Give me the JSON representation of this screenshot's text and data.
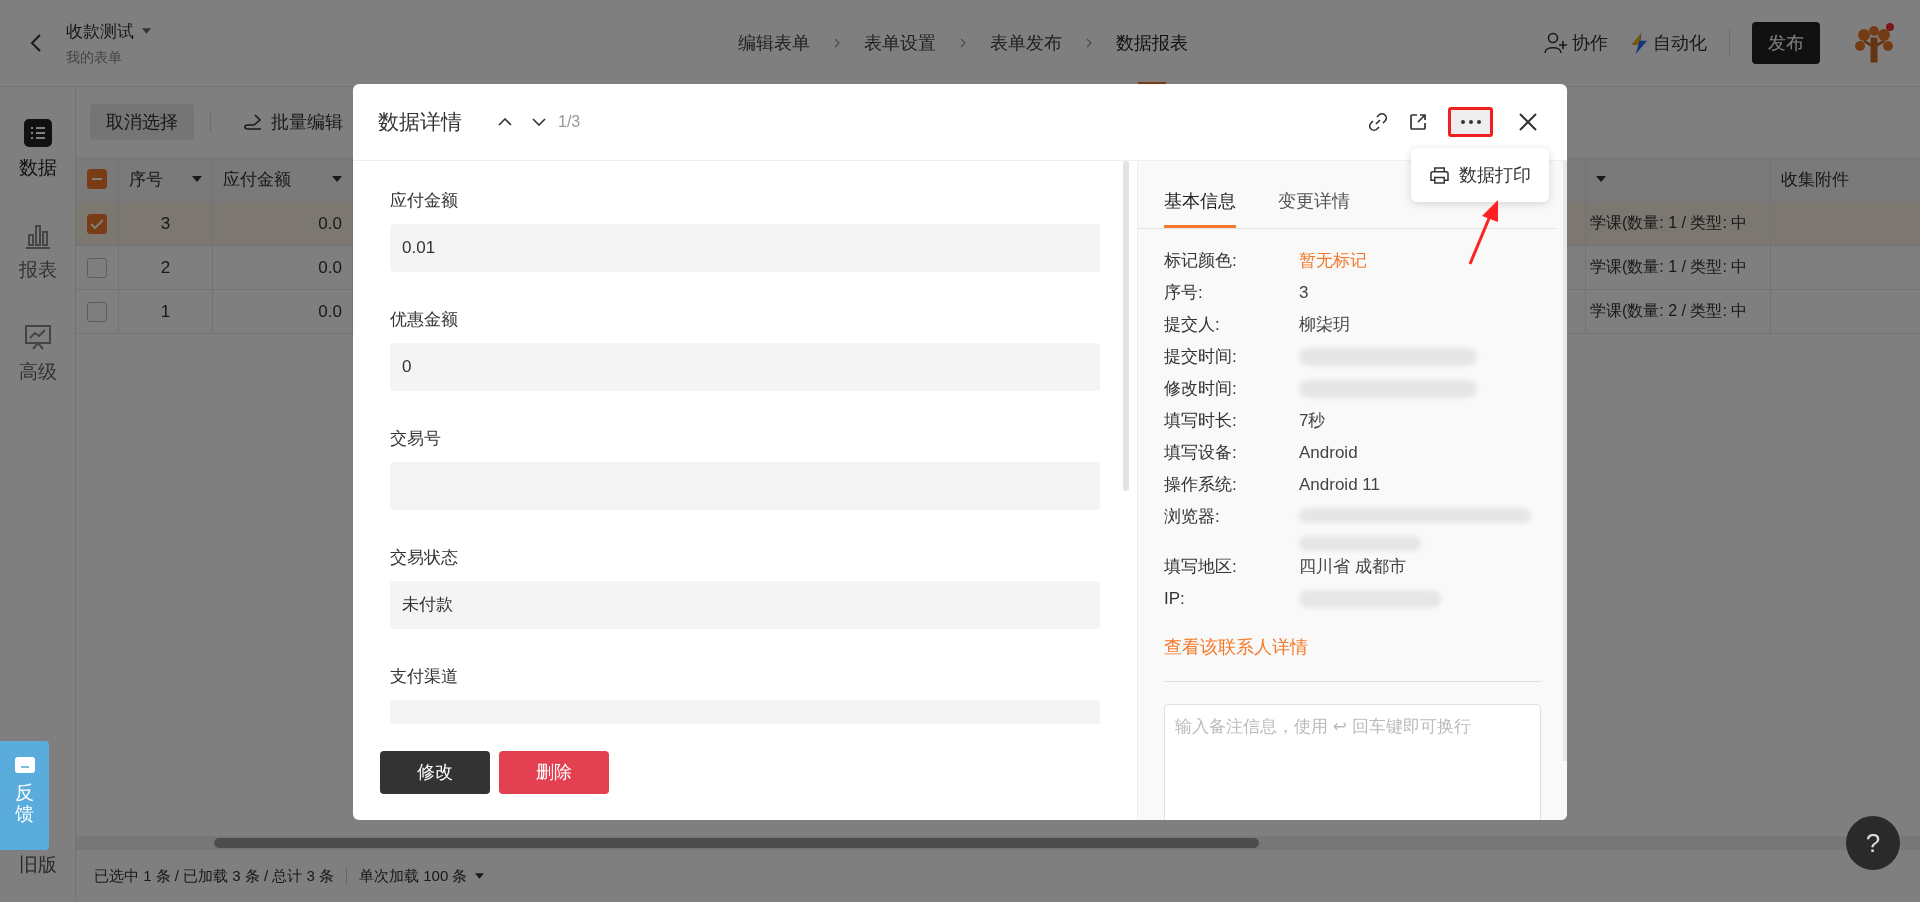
{
  "header": {
    "title": "收款测试",
    "subtitle": "我的表单",
    "steps": [
      {
        "label": "编辑表单",
        "selected": false
      },
      {
        "label": "表单设置",
        "selected": false
      },
      {
        "label": "表单发布",
        "selected": false
      },
      {
        "label": "数据报表",
        "selected": true
      }
    ],
    "actions": [
      {
        "kind": "collab",
        "label": "协作"
      },
      {
        "kind": "automation",
        "label": "自动化"
      }
    ],
    "publish_button": "发布"
  },
  "sidebar": {
    "items": [
      {
        "kind": "data",
        "label": "数据",
        "selected": true
      },
      {
        "kind": "report",
        "label": "报表",
        "selected": false
      },
      {
        "kind": "advanced",
        "label": "高级",
        "selected": false
      }
    ],
    "feedback": "反馈",
    "legacy": "旧版"
  },
  "toolbar": {
    "buttons": [
      {
        "kind": "cancel",
        "label": "取消选择"
      },
      {
        "kind": "batch_edit",
        "label": "批量编辑"
      }
    ]
  },
  "table": {
    "header_indeterminate": true,
    "columns": [
      {
        "label": "序号",
        "menu": true
      },
      {
        "label": "应付金额",
        "menu": true
      },
      {
        "menu": true
      },
      {
        "label": "收集附件",
        "menu": false
      }
    ],
    "rows": [
      {
        "selected": true,
        "seq": "3",
        "amount": "0.0",
        "column_4": "学课(数量: 1 / 类型: 中"
      },
      {
        "selected": false,
        "seq": "2",
        "amount": "0.0",
        "column_4": "学课(数量: 1 / 类型: 中"
      },
      {
        "selected": false,
        "seq": "1",
        "amount": "0.0",
        "column_4": "学课(数量: 2 / 类型: 中"
      }
    ]
  },
  "status_bar": {
    "summary": "已选中 1 条 / 已加载 3 条 / 总计 3 条",
    "page_size": "单次加载 100 条"
  },
  "modal": {
    "title": "数据详情",
    "position": "1/3",
    "fields": [
      {
        "label": "应付金额",
        "value": "0.01"
      },
      {
        "label": "优惠金额",
        "value": "0"
      },
      {
        "label": "交易号"
      },
      {
        "label": "交易状态",
        "value": "未付款"
      },
      {
        "label": "支付渠道"
      }
    ],
    "buttons": [
      {
        "kind": "edit",
        "label": "修改"
      },
      {
        "kind": "delete",
        "label": "删除"
      }
    ],
    "tabs": [
      {
        "label": "基本信息",
        "selected": true
      },
      {
        "label": "变更详情",
        "selected": false
      }
    ],
    "info": [
      {
        "kind": "accent",
        "label": "标记颜色:",
        "value": "暂无标记"
      },
      {
        "kind": "text",
        "label": "序号:",
        "value": "3"
      },
      {
        "kind": "text",
        "label": "提交人:",
        "value": "柳柒玥"
      },
      {
        "kind": "redacted",
        "label": "提交时间:"
      },
      {
        "kind": "redacted",
        "label": "修改时间:"
      },
      {
        "kind": "text",
        "label": "填写时长:",
        "value": "7秒"
      },
      {
        "kind": "text",
        "label": "填写设备:",
        "value": "Android"
      },
      {
        "kind": "text",
        "label": "操作系统:",
        "value": "Android 11"
      },
      {
        "kind": "redacted_long",
        "label": "浏览器:"
      },
      {
        "kind": "text",
        "label": "填写地区:",
        "value": "四川省 成都市"
      },
      {
        "kind": "redacted_short",
        "label": "IP:"
      }
    ],
    "contact_link": "查看该联系人详情",
    "note_placeholder": "输入备注信息，使用 ↩ 回车键即可换行",
    "menu_items": [
      "数据打印"
    ]
  },
  "help": "?"
}
